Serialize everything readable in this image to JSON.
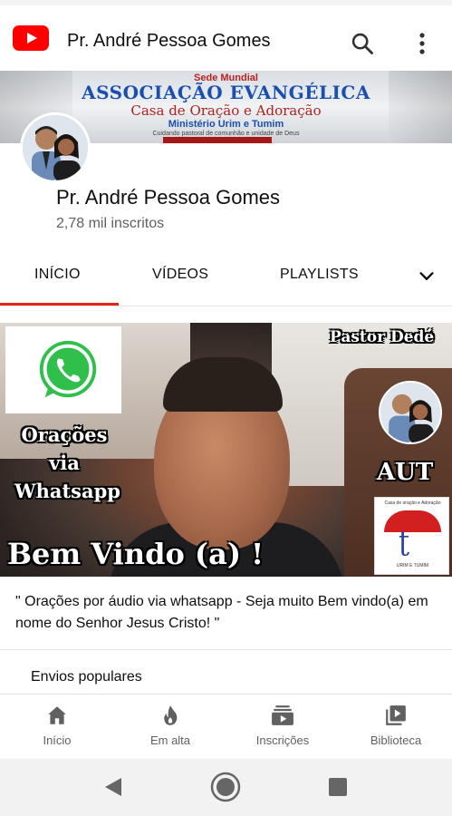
{
  "topbar": {
    "channel_title": "Pr. André Pessoa Gomes",
    "logo_icon": "youtube-logo-icon",
    "search_icon": "search-icon",
    "more_icon": "more-vert-icon"
  },
  "banner": {
    "line1": "Sede Mundial",
    "line2": "ASSOCIAÇÃO EVANGÉLICA",
    "line3": "Casa de Oração e Adoração",
    "line4": "Ministério Urim e Tumim",
    "line5": "Cuidando pastoral de comunhão e unidade de Deus"
  },
  "channel": {
    "name": "Pr. André Pessoa Gomes",
    "subscribers": "2,78 mil inscritos"
  },
  "tabs": [
    {
      "label": "INÍCIO",
      "active": true
    },
    {
      "label": "VÍDEOS",
      "active": false
    },
    {
      "label": "PLAYLISTS",
      "active": false
    }
  ],
  "tabs_more_icon": "chevron-down-icon",
  "featured_video": {
    "overlay_pastor": "Pastor Dedé",
    "overlay_oracoes": "Orações via Whatsapp",
    "overlay_aut": "AUT",
    "overlay_bemvindo": "Bem Vindo (a) !",
    "logo_top": "Casa de oração e Adoração",
    "logo_bottom": "URIM E TUMIM"
  },
  "description": "\" Orações por áudio via whatsapp - Seja muito Bem vindo(a) em nome do Senhor Jesus Cristo! \"",
  "section_title": "Envios populares",
  "bottom_nav": [
    {
      "label": "Início",
      "icon": "home-icon"
    },
    {
      "label": "Em alta",
      "icon": "flame-icon"
    },
    {
      "label": "Inscrições",
      "icon": "subscriptions-icon"
    },
    {
      "label": "Biblioteca",
      "icon": "library-icon"
    }
  ],
  "colors": {
    "accent": "#e62117",
    "youtube_red": "#ff0000",
    "secondary_text": "#606060"
  }
}
